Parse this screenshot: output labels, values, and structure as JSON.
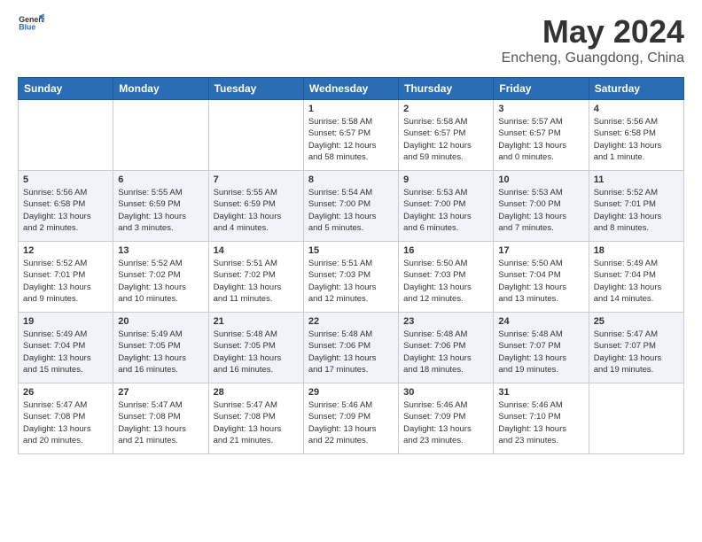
{
  "header": {
    "logo_text_general": "General",
    "logo_text_blue": "Blue",
    "main_title": "May 2024",
    "subtitle": "Encheng, Guangdong, China"
  },
  "weekdays": [
    "Sunday",
    "Monday",
    "Tuesday",
    "Wednesday",
    "Thursday",
    "Friday",
    "Saturday"
  ],
  "weeks": [
    {
      "days": [
        {
          "number": "",
          "info": ""
        },
        {
          "number": "",
          "info": ""
        },
        {
          "number": "",
          "info": ""
        },
        {
          "number": "1",
          "info": "Sunrise: 5:58 AM\nSunset: 6:57 PM\nDaylight: 12 hours\nand 58 minutes."
        },
        {
          "number": "2",
          "info": "Sunrise: 5:58 AM\nSunset: 6:57 PM\nDaylight: 12 hours\nand 59 minutes."
        },
        {
          "number": "3",
          "info": "Sunrise: 5:57 AM\nSunset: 6:57 PM\nDaylight: 13 hours\nand 0 minutes."
        },
        {
          "number": "4",
          "info": "Sunrise: 5:56 AM\nSunset: 6:58 PM\nDaylight: 13 hours\nand 1 minute."
        }
      ]
    },
    {
      "days": [
        {
          "number": "5",
          "info": "Sunrise: 5:56 AM\nSunset: 6:58 PM\nDaylight: 13 hours\nand 2 minutes."
        },
        {
          "number": "6",
          "info": "Sunrise: 5:55 AM\nSunset: 6:59 PM\nDaylight: 13 hours\nand 3 minutes."
        },
        {
          "number": "7",
          "info": "Sunrise: 5:55 AM\nSunset: 6:59 PM\nDaylight: 13 hours\nand 4 minutes."
        },
        {
          "number": "8",
          "info": "Sunrise: 5:54 AM\nSunset: 7:00 PM\nDaylight: 13 hours\nand 5 minutes."
        },
        {
          "number": "9",
          "info": "Sunrise: 5:53 AM\nSunset: 7:00 PM\nDaylight: 13 hours\nand 6 minutes."
        },
        {
          "number": "10",
          "info": "Sunrise: 5:53 AM\nSunset: 7:00 PM\nDaylight: 13 hours\nand 7 minutes."
        },
        {
          "number": "11",
          "info": "Sunrise: 5:52 AM\nSunset: 7:01 PM\nDaylight: 13 hours\nand 8 minutes."
        }
      ]
    },
    {
      "days": [
        {
          "number": "12",
          "info": "Sunrise: 5:52 AM\nSunset: 7:01 PM\nDaylight: 13 hours\nand 9 minutes."
        },
        {
          "number": "13",
          "info": "Sunrise: 5:52 AM\nSunset: 7:02 PM\nDaylight: 13 hours\nand 10 minutes."
        },
        {
          "number": "14",
          "info": "Sunrise: 5:51 AM\nSunset: 7:02 PM\nDaylight: 13 hours\nand 11 minutes."
        },
        {
          "number": "15",
          "info": "Sunrise: 5:51 AM\nSunset: 7:03 PM\nDaylight: 13 hours\nand 12 minutes."
        },
        {
          "number": "16",
          "info": "Sunrise: 5:50 AM\nSunset: 7:03 PM\nDaylight: 13 hours\nand 12 minutes."
        },
        {
          "number": "17",
          "info": "Sunrise: 5:50 AM\nSunset: 7:04 PM\nDaylight: 13 hours\nand 13 minutes."
        },
        {
          "number": "18",
          "info": "Sunrise: 5:49 AM\nSunset: 7:04 PM\nDaylight: 13 hours\nand 14 minutes."
        }
      ]
    },
    {
      "days": [
        {
          "number": "19",
          "info": "Sunrise: 5:49 AM\nSunset: 7:04 PM\nDaylight: 13 hours\nand 15 minutes."
        },
        {
          "number": "20",
          "info": "Sunrise: 5:49 AM\nSunset: 7:05 PM\nDaylight: 13 hours\nand 16 minutes."
        },
        {
          "number": "21",
          "info": "Sunrise: 5:48 AM\nSunset: 7:05 PM\nDaylight: 13 hours\nand 16 minutes."
        },
        {
          "number": "22",
          "info": "Sunrise: 5:48 AM\nSunset: 7:06 PM\nDaylight: 13 hours\nand 17 minutes."
        },
        {
          "number": "23",
          "info": "Sunrise: 5:48 AM\nSunset: 7:06 PM\nDaylight: 13 hours\nand 18 minutes."
        },
        {
          "number": "24",
          "info": "Sunrise: 5:48 AM\nSunset: 7:07 PM\nDaylight: 13 hours\nand 19 minutes."
        },
        {
          "number": "25",
          "info": "Sunrise: 5:47 AM\nSunset: 7:07 PM\nDaylight: 13 hours\nand 19 minutes."
        }
      ]
    },
    {
      "days": [
        {
          "number": "26",
          "info": "Sunrise: 5:47 AM\nSunset: 7:08 PM\nDaylight: 13 hours\nand 20 minutes."
        },
        {
          "number": "27",
          "info": "Sunrise: 5:47 AM\nSunset: 7:08 PM\nDaylight: 13 hours\nand 21 minutes."
        },
        {
          "number": "28",
          "info": "Sunrise: 5:47 AM\nSunset: 7:08 PM\nDaylight: 13 hours\nand 21 minutes."
        },
        {
          "number": "29",
          "info": "Sunrise: 5:46 AM\nSunset: 7:09 PM\nDaylight: 13 hours\nand 22 minutes."
        },
        {
          "number": "30",
          "info": "Sunrise: 5:46 AM\nSunset: 7:09 PM\nDaylight: 13 hours\nand 23 minutes."
        },
        {
          "number": "31",
          "info": "Sunrise: 5:46 AM\nSunset: 7:10 PM\nDaylight: 13 hours\nand 23 minutes."
        },
        {
          "number": "",
          "info": ""
        }
      ]
    }
  ]
}
